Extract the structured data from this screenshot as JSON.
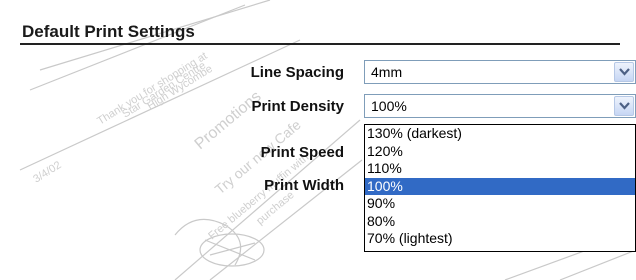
{
  "panel": {
    "title": "Default Print Settings"
  },
  "fields": {
    "line_spacing": {
      "label": "Line Spacing",
      "value": "4mm"
    },
    "print_density": {
      "label": "Print Density",
      "value": "100%"
    },
    "print_speed": {
      "label": "Print Speed"
    },
    "print_width": {
      "label": "Print Width"
    }
  },
  "density_options": [
    "130% (darkest)",
    "120%",
    "110%",
    "100%",
    "90%",
    "80%",
    "70% (lightest)"
  ],
  "selected_option": "100%",
  "background_receipt_text": [
    "Thank you for shopping at",
    "Star Garden Centre",
    "High Wycombe",
    "3/4/02",
    "Promotions",
    "Try our new Cafe",
    "Free blueberry muffin with",
    "purchase"
  ],
  "colors": {
    "selection": "#316ac5",
    "combo_border": "#7f9db9"
  }
}
